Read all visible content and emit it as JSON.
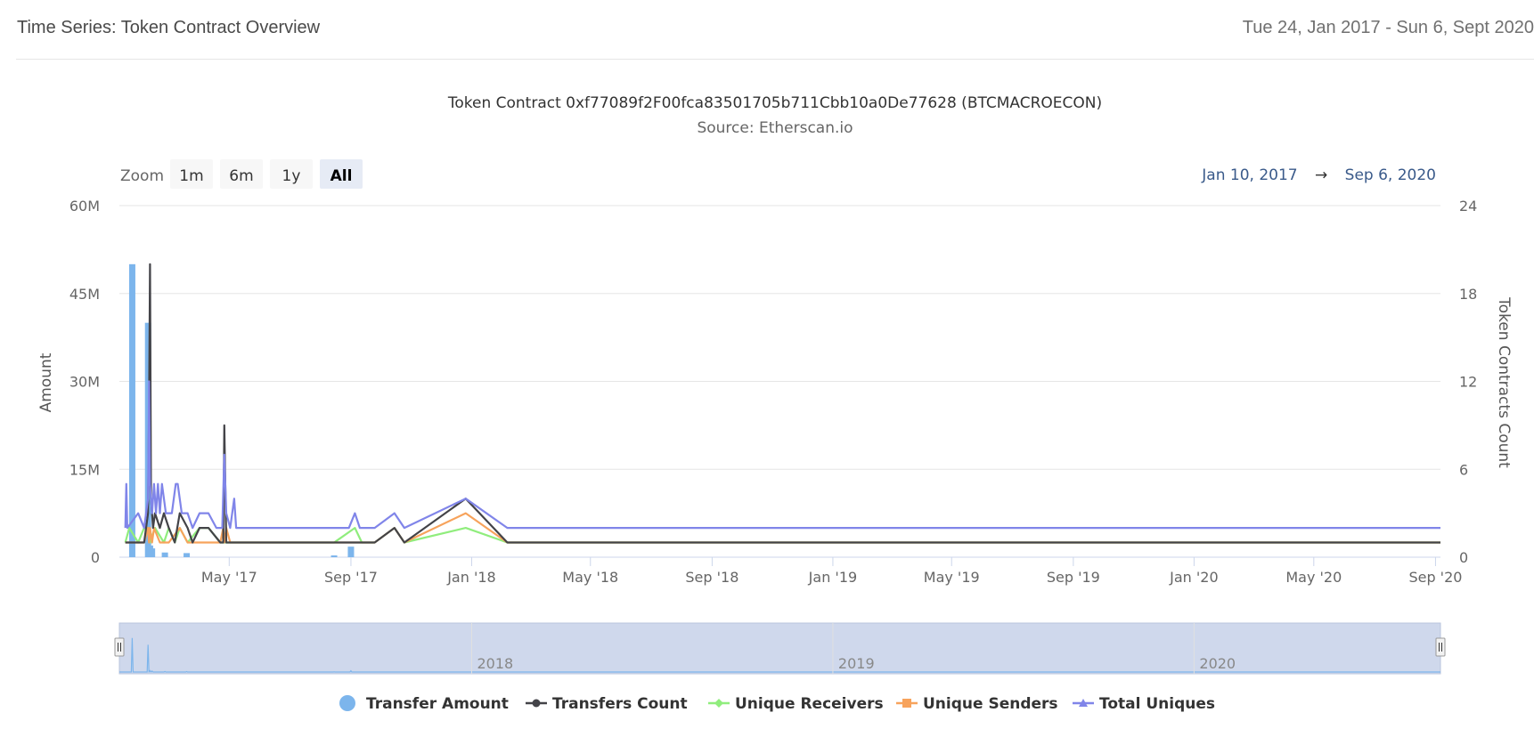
{
  "header": {
    "title": "Time Series: Token Contract Overview",
    "date_span": "Tue 24, Jan 2017 - Sun 6, Sept 2020"
  },
  "range_selector": {
    "zoom_label": "Zoom",
    "buttons": [
      "1m",
      "6m",
      "1y",
      "All"
    ],
    "selected": "All",
    "from": "Jan 10, 2017",
    "arrow": "→",
    "to": "Sep 6, 2020"
  },
  "navigator": {
    "labels": [
      "2018",
      "2019",
      "2020"
    ]
  },
  "colors": {
    "transfer_amount": "#7cb5ec",
    "transfers_count": "#434348",
    "unique_receivers": "#90ed7d",
    "unique_senders": "#f7a35c",
    "total_uniques": "#8085e9",
    "navigator_fill": "#cfd8ec"
  },
  "chart_data": {
    "type": "line",
    "title": "Token Contract 0xf77089f2F00fca83501705b711Cbb10a0De77628 (BTCMACROECON)",
    "subtitle": "Source: Etherscan.io",
    "ylabel": "Amount",
    "y2label": "Token Contracts Count",
    "ylim": [
      0,
      60000000
    ],
    "y2lim": [
      0,
      24
    ],
    "yticks": [
      "0",
      "15M",
      "30M",
      "45M",
      "60M"
    ],
    "y2ticks": [
      "0",
      "6",
      "12",
      "18",
      "24"
    ],
    "xlim": [
      "2017-01-10",
      "2020-09-06"
    ],
    "xticks": [
      {
        "date": "2017-05-01",
        "label": "May '17"
      },
      {
        "date": "2017-09-01",
        "label": "Sep '17"
      },
      {
        "date": "2018-01-01",
        "label": "Jan '18"
      },
      {
        "date": "2018-05-01",
        "label": "May '18"
      },
      {
        "date": "2018-09-01",
        "label": "Sep '18"
      },
      {
        "date": "2019-01-01",
        "label": "Jan '19"
      },
      {
        "date": "2019-05-01",
        "label": "May '19"
      },
      {
        "date": "2019-09-01",
        "label": "Sep '19"
      },
      {
        "date": "2020-01-01",
        "label": "Jan '20"
      },
      {
        "date": "2020-05-01",
        "label": "May '20"
      },
      {
        "date": "2020-09-01",
        "label": "Sep '20"
      }
    ],
    "legend_position": "bottom-center",
    "grid": true,
    "bars": {
      "name": "Transfer Amount",
      "axis": "left",
      "points": [
        [
          "2017-01-23",
          50000000
        ],
        [
          "2017-02-08",
          40000000
        ],
        [
          "2017-02-10",
          2000000
        ],
        [
          "2017-02-12",
          1500000
        ],
        [
          "2017-02-25",
          800000
        ],
        [
          "2017-03-19",
          700000
        ],
        [
          "2017-08-15",
          300000
        ],
        [
          "2017-09-01",
          1800000
        ]
      ]
    },
    "series": [
      {
        "name": "Transfers Count",
        "axis": "right",
        "points": [
          [
            "2017-01-16",
            1
          ],
          [
            "2017-01-20",
            1
          ],
          [
            "2017-01-29",
            1
          ],
          [
            "2017-02-04",
            1
          ],
          [
            "2017-02-08",
            3
          ],
          [
            "2017-02-09",
            10
          ],
          [
            "2017-02-10",
            20
          ],
          [
            "2017-02-11",
            4
          ],
          [
            "2017-02-13",
            2
          ],
          [
            "2017-02-15",
            3
          ],
          [
            "2017-02-20",
            2
          ],
          [
            "2017-02-24",
            3
          ],
          [
            "2017-03-01",
            2
          ],
          [
            "2017-03-07",
            1
          ],
          [
            "2017-03-12",
            3
          ],
          [
            "2017-03-20",
            2
          ],
          [
            "2017-03-25",
            1
          ],
          [
            "2017-04-01",
            2
          ],
          [
            "2017-04-10",
            2
          ],
          [
            "2017-04-22",
            1
          ],
          [
            "2017-04-25",
            1
          ],
          [
            "2017-04-26",
            9
          ],
          [
            "2017-04-28",
            1
          ],
          [
            "2017-05-10",
            1
          ],
          [
            "2017-08-15",
            1
          ],
          [
            "2017-09-05",
            1
          ],
          [
            "2017-09-25",
            1
          ],
          [
            "2017-10-15",
            2
          ],
          [
            "2017-10-25",
            1
          ],
          [
            "2017-12-26",
            4
          ],
          [
            "2018-02-06",
            1
          ],
          [
            "2020-09-06",
            1
          ]
        ]
      },
      {
        "name": "Unique Receivers",
        "axis": "right",
        "points": [
          [
            "2017-01-16",
            1
          ],
          [
            "2017-01-20",
            2
          ],
          [
            "2017-01-29",
            1
          ],
          [
            "2017-02-04",
            2
          ],
          [
            "2017-02-08",
            2
          ],
          [
            "2017-02-10",
            1
          ],
          [
            "2017-02-15",
            2
          ],
          [
            "2017-02-24",
            1
          ],
          [
            "2017-03-01",
            2
          ],
          [
            "2017-03-07",
            1
          ],
          [
            "2017-03-12",
            2
          ],
          [
            "2017-03-20",
            1
          ],
          [
            "2017-04-01",
            2
          ],
          [
            "2017-04-10",
            2
          ],
          [
            "2017-04-22",
            1
          ],
          [
            "2017-05-10",
            1
          ],
          [
            "2017-08-15",
            1
          ],
          [
            "2017-09-05",
            2
          ],
          [
            "2017-09-12",
            1
          ],
          [
            "2017-09-25",
            1
          ],
          [
            "2017-10-15",
            2
          ],
          [
            "2017-10-25",
            1
          ],
          [
            "2017-12-26",
            2
          ],
          [
            "2018-02-06",
            1
          ],
          [
            "2020-09-06",
            1
          ]
        ]
      },
      {
        "name": "Unique Senders",
        "axis": "right",
        "points": [
          [
            "2017-01-16",
            1
          ],
          [
            "2017-01-20",
            1
          ],
          [
            "2017-01-29",
            1
          ],
          [
            "2017-02-04",
            1
          ],
          [
            "2017-02-08",
            2
          ],
          [
            "2017-02-09",
            1
          ],
          [
            "2017-02-10",
            2
          ],
          [
            "2017-02-12",
            1
          ],
          [
            "2017-02-14",
            2
          ],
          [
            "2017-02-20",
            1
          ],
          [
            "2017-02-24",
            1
          ],
          [
            "2017-03-01",
            1
          ],
          [
            "2017-03-12",
            2
          ],
          [
            "2017-03-20",
            1
          ],
          [
            "2017-04-01",
            1
          ],
          [
            "2017-04-22",
            1
          ],
          [
            "2017-04-25",
            2
          ],
          [
            "2017-04-26",
            1
          ],
          [
            "2017-04-28",
            2
          ],
          [
            "2017-05-02",
            1
          ],
          [
            "2017-08-15",
            1
          ],
          [
            "2017-09-25",
            1
          ],
          [
            "2017-10-15",
            2
          ],
          [
            "2017-10-25",
            1
          ],
          [
            "2017-12-26",
            3
          ],
          [
            "2018-02-06",
            1
          ],
          [
            "2020-09-06",
            1
          ]
        ]
      },
      {
        "name": "Total Uniques",
        "axis": "right",
        "points": [
          [
            "2017-01-16",
            2
          ],
          [
            "2017-01-17",
            5
          ],
          [
            "2017-01-18",
            2
          ],
          [
            "2017-01-29",
            3
          ],
          [
            "2017-02-04",
            2
          ],
          [
            "2017-02-08",
            4
          ],
          [
            "2017-02-09",
            12
          ],
          [
            "2017-02-10",
            5
          ],
          [
            "2017-02-12",
            3
          ],
          [
            "2017-02-14",
            5
          ],
          [
            "2017-02-16",
            3
          ],
          [
            "2017-02-18",
            5
          ],
          [
            "2017-02-20",
            3
          ],
          [
            "2017-02-22",
            5
          ],
          [
            "2017-02-26",
            3
          ],
          [
            "2017-03-04",
            3
          ],
          [
            "2017-03-08",
            5
          ],
          [
            "2017-03-10",
            5
          ],
          [
            "2017-03-14",
            3
          ],
          [
            "2017-03-20",
            3
          ],
          [
            "2017-03-25",
            2
          ],
          [
            "2017-04-01",
            3
          ],
          [
            "2017-04-10",
            3
          ],
          [
            "2017-04-18",
            2
          ],
          [
            "2017-04-24",
            2
          ],
          [
            "2017-04-26",
            7
          ],
          [
            "2017-04-28",
            3
          ],
          [
            "2017-05-02",
            2
          ],
          [
            "2017-05-06",
            4
          ],
          [
            "2017-05-08",
            2
          ],
          [
            "2017-08-30",
            2
          ],
          [
            "2017-09-05",
            3
          ],
          [
            "2017-09-10",
            2
          ],
          [
            "2017-09-25",
            2
          ],
          [
            "2017-10-15",
            3
          ],
          [
            "2017-10-25",
            2
          ],
          [
            "2017-12-26",
            4
          ],
          [
            "2018-02-06",
            2
          ],
          [
            "2020-09-06",
            2
          ]
        ]
      }
    ]
  }
}
